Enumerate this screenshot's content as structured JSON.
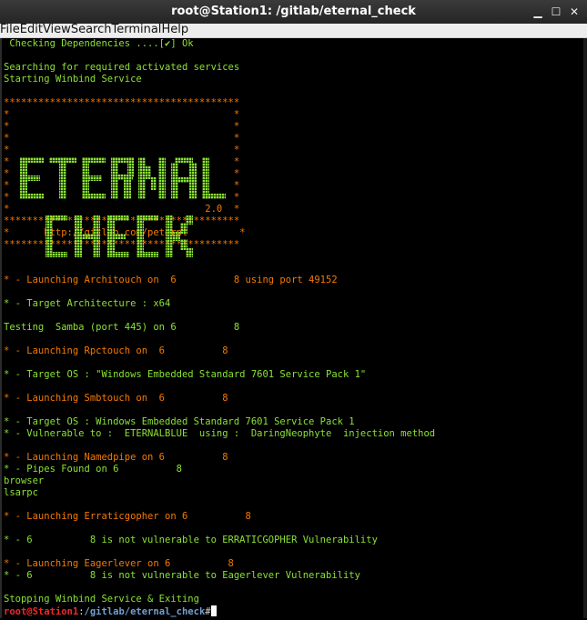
{
  "window": {
    "title": "root@Station1: /gitlab/eternal_check"
  },
  "menu": [
    "File",
    "Edit",
    "View",
    "Search",
    "Terminal",
    "Help"
  ],
  "lines": [
    {
      "t": " Checking Dependencies ....[✔] Ok",
      "c": "g"
    },
    {
      "t": "",
      "c": "g"
    },
    {
      "t": "Searching for required activated services",
      "c": "g"
    },
    {
      "t": "Starting Winbind Service",
      "c": "g"
    },
    {
      "t": "",
      "c": "g"
    },
    {
      "t": "*****************************************",
      "c": "o"
    },
    {
      "t": "*                                       *",
      "c": "o"
    },
    {
      "t": "*                                       *",
      "c": "o"
    },
    {
      "t": "*                                       *",
      "c": "o"
    },
    {
      "t": "*                                       *",
      "c": "o"
    },
    {
      "t": "*                                       *",
      "c": "o"
    },
    {
      "t": "*                                       *",
      "c": "o"
    },
    {
      "t": "*                                       *",
      "c": "o"
    },
    {
      "t": "*                                       *",
      "c": "o"
    },
    {
      "t": "*                                  2.0  *",
      "c": "o"
    },
    {
      "t": "*****************************************",
      "c": "o"
    },
    {
      "t": "*      http://gitlab.com/peterpt         *",
      "c": "o"
    },
    {
      "t": "*****************************************",
      "c": "o"
    },
    {
      "t": "",
      "c": "g"
    },
    {
      "t": "",
      "c": "g"
    },
    {
      "t": "* - Launching Architouch on  6          8 using port 49152",
      "c": "o"
    },
    {
      "t": "",
      "c": "g"
    },
    {
      "t": "* - Target Architecture : x64",
      "c": "g"
    },
    {
      "t": "",
      "c": "g"
    },
    {
      "t": "Testing  Samba (port 445) on 6          8",
      "c": "g"
    },
    {
      "t": "",
      "c": "g"
    },
    {
      "t": "* - Launching Rpctouch on  6          8",
      "c": "o"
    },
    {
      "t": "",
      "c": "g"
    },
    {
      "t": "* - Target OS : \"Windows Embedded Standard 7601 Service Pack 1\"",
      "c": "g"
    },
    {
      "t": "",
      "c": "g"
    },
    {
      "t": "* - Launching Smbtouch on  6          8",
      "c": "o"
    },
    {
      "t": "",
      "c": "g"
    },
    {
      "t": "* - Target OS : Windows Embedded Standard 7601 Service Pack 1",
      "c": "g"
    },
    {
      "t": "* - Vulnerable to :  ETERNALBLUE  using :  DaringNeophyte  injection method",
      "c": "g"
    },
    {
      "t": "",
      "c": "g"
    },
    {
      "t": "* - Launching Namedpipe on 6          8",
      "c": "o"
    },
    {
      "t": "* - Pipes Found on 6          8",
      "c": "g"
    },
    {
      "t": "browser",
      "c": "g"
    },
    {
      "t": "lsarpc",
      "c": "g"
    },
    {
      "t": "",
      "c": "g"
    },
    {
      "t": "* - Launching Erraticgopher on 6          8",
      "c": "o"
    },
    {
      "t": "",
      "c": "g"
    },
    {
      "t": "* - 6          8 is not vulnerable to ERRATICGOPHER Vulnerability",
      "c": "g"
    },
    {
      "t": "",
      "c": "g"
    },
    {
      "t": "* - Launching Eagerlever on 6          8",
      "c": "o"
    },
    {
      "t": "* - 6          8 is not vulnerable to Eagerlever Vulnerability",
      "c": "g"
    },
    {
      "t": "",
      "c": "g"
    },
    {
      "t": "Stopping Winbind Service & Exiting",
      "c": "g"
    }
  ],
  "prompt": {
    "user": "root@Station1",
    "sep": ":",
    "path": "/gitlab/eternal_check",
    "symbol": "#"
  },
  "colors": {
    "green": "#8ae234",
    "orange": "#f57900",
    "prompt_user": "#ef2929",
    "prompt_path": "#729fcf"
  }
}
